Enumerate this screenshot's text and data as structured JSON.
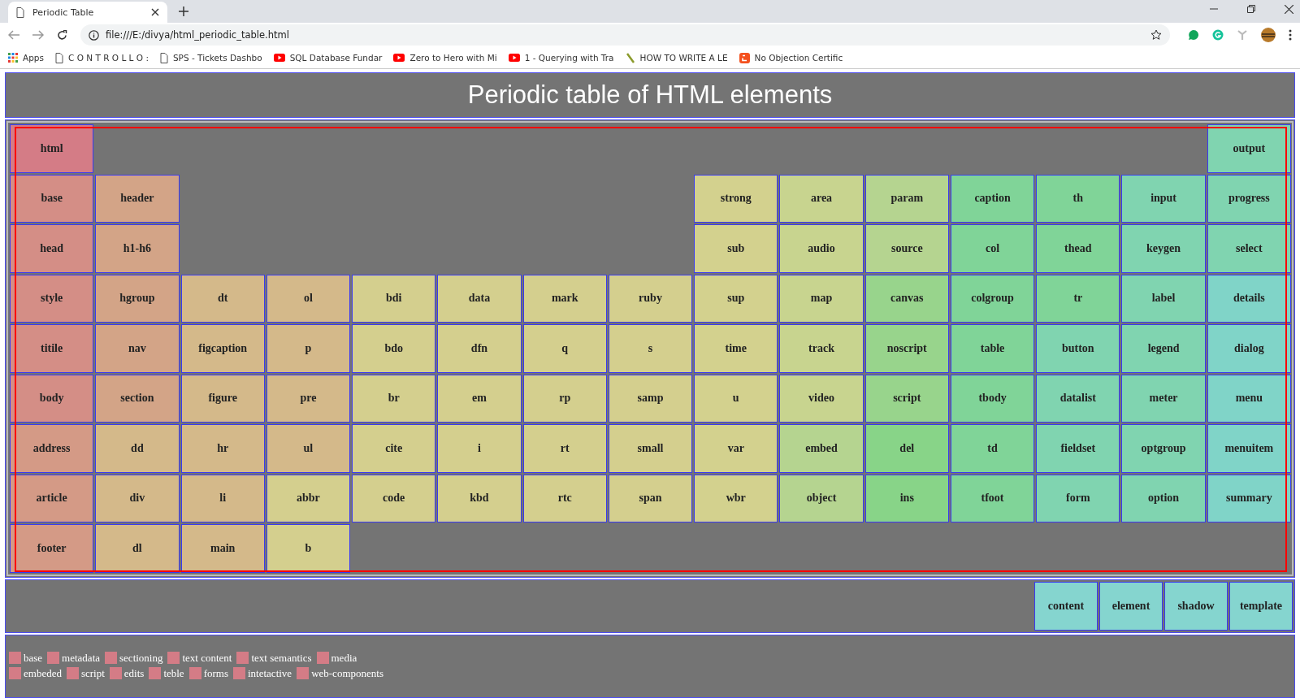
{
  "browser": {
    "tab_title": "Periodic Table",
    "address": "file:///E:/divya/html_periodic_table.html",
    "bookmarks": [
      {
        "label": "Apps",
        "kind": "apps"
      },
      {
        "label": "C O N T R O L L O :",
        "kind": "page"
      },
      {
        "label": "SPS - Tickets Dashbo",
        "kind": "page"
      },
      {
        "label": "SQL Database Fundar",
        "kind": "video"
      },
      {
        "label": "Zero to Hero with Mi",
        "kind": "video"
      },
      {
        "label": "1 - Querying with Tra",
        "kind": "video"
      },
      {
        "label": "HOW TO WRITE A LE",
        "kind": "pen"
      },
      {
        "label": "No Objection Certific",
        "kind": "blog"
      }
    ]
  },
  "page": {
    "title": "Periodic table of HTML elements",
    "rows": [
      [
        {
          "symbol": "html",
          "color": "#d47c86"
        },
        null,
        null,
        null,
        null,
        null,
        null,
        null,
        null,
        null,
        null,
        null,
        null,
        null,
        {
          "symbol": "output",
          "color": "#80d4b0"
        }
      ],
      [
        {
          "symbol": "base",
          "color": "#d48e86"
        },
        {
          "symbol": "header",
          "color": "#d3a487"
        },
        null,
        null,
        null,
        null,
        null,
        null,
        {
          "symbol": "strong",
          "color": "#d3d18e"
        },
        {
          "symbol": "area",
          "color": "#c8d48f"
        },
        {
          "symbol": "param",
          "color": "#b5d490"
        },
        {
          "symbol": "caption",
          "color": "#80d498"
        },
        {
          "symbol": "th",
          "color": "#80d498"
        },
        {
          "symbol": "input",
          "color": "#80d4b0"
        },
        {
          "symbol": "progress",
          "color": "#80d4b0"
        }
      ],
      [
        {
          "symbol": "head",
          "color": "#d48e86"
        },
        {
          "symbol": "h1-h6",
          "color": "#d3a487"
        },
        null,
        null,
        null,
        null,
        null,
        null,
        {
          "symbol": "sub",
          "color": "#d3d18e"
        },
        {
          "symbol": "audio",
          "color": "#c8d48f"
        },
        {
          "symbol": "source",
          "color": "#b5d490"
        },
        {
          "symbol": "col",
          "color": "#80d498"
        },
        {
          "symbol": "thead",
          "color": "#80d498"
        },
        {
          "symbol": "keygen",
          "color": "#80d4b0"
        },
        {
          "symbol": "select",
          "color": "#80d4b0"
        }
      ],
      [
        {
          "symbol": "style",
          "color": "#d48e86"
        },
        {
          "symbol": "hgroup",
          "color": "#d3a487"
        },
        {
          "symbol": "dt",
          "color": "#d4b98a"
        },
        {
          "symbol": "ol",
          "color": "#d4b98a"
        },
        {
          "symbol": "bdi",
          "color": "#d4cf8e"
        },
        {
          "symbol": "data",
          "color": "#d4cf8e"
        },
        {
          "symbol": "mark",
          "color": "#d4cf8e"
        },
        {
          "symbol": "ruby",
          "color": "#d4cf8e"
        },
        {
          "symbol": "sup",
          "color": "#d3d18e"
        },
        {
          "symbol": "map",
          "color": "#c8d48f"
        },
        {
          "symbol": "canvas",
          "color": "#98d48c"
        },
        {
          "symbol": "colgroup",
          "color": "#80d498"
        },
        {
          "symbol": "tr",
          "color": "#80d498"
        },
        {
          "symbol": "label",
          "color": "#80d4b0"
        },
        {
          "symbol": "details",
          "color": "#80d4c8"
        }
      ],
      [
        {
          "symbol": "titile",
          "color": "#d48e86"
        },
        {
          "symbol": "nav",
          "color": "#d3a487"
        },
        {
          "symbol": "figcaption",
          "color": "#d4b98a"
        },
        {
          "symbol": "p",
          "color": "#d4b98a"
        },
        {
          "symbol": "bdo",
          "color": "#d4cf8e"
        },
        {
          "symbol": "dfn",
          "color": "#d4cf8e"
        },
        {
          "symbol": "q",
          "color": "#d4cf8e"
        },
        {
          "symbol": "s",
          "color": "#d4cf8e"
        },
        {
          "symbol": "time",
          "color": "#d3d18e"
        },
        {
          "symbol": "track",
          "color": "#c8d48f"
        },
        {
          "symbol": "noscript",
          "color": "#98d48c"
        },
        {
          "symbol": "table",
          "color": "#80d498"
        },
        {
          "symbol": "button",
          "color": "#80d4b0"
        },
        {
          "symbol": "legend",
          "color": "#80d4b0"
        },
        {
          "symbol": "dialog",
          "color": "#80d4c8"
        }
      ],
      [
        {
          "symbol": "body",
          "color": "#d48e86"
        },
        {
          "symbol": "section",
          "color": "#d3a487"
        },
        {
          "symbol": "figure",
          "color": "#d4b98a"
        },
        {
          "symbol": "pre",
          "color": "#d4b98a"
        },
        {
          "symbol": "br",
          "color": "#d4cf8e"
        },
        {
          "symbol": "em",
          "color": "#d4cf8e"
        },
        {
          "symbol": "rp",
          "color": "#d4cf8e"
        },
        {
          "symbol": "samp",
          "color": "#d4cf8e"
        },
        {
          "symbol": "u",
          "color": "#d3d18e"
        },
        {
          "symbol": "video",
          "color": "#c8d48f"
        },
        {
          "symbol": "script",
          "color": "#98d48c"
        },
        {
          "symbol": "tbody",
          "color": "#80d498"
        },
        {
          "symbol": "datalist",
          "color": "#80d4b0"
        },
        {
          "symbol": "meter",
          "color": "#80d4b0"
        },
        {
          "symbol": "menu",
          "color": "#80d4c8"
        }
      ],
      [
        {
          "symbol": "address",
          "color": "#d49a86"
        },
        {
          "symbol": "dd",
          "color": "#d4b98a"
        },
        {
          "symbol": "hr",
          "color": "#d4b98a"
        },
        {
          "symbol": "ul",
          "color": "#d4b98a"
        },
        {
          "symbol": "cite",
          "color": "#d4cf8e"
        },
        {
          "symbol": "i",
          "color": "#d4cf8e"
        },
        {
          "symbol": "rt",
          "color": "#d4cf8e"
        },
        {
          "symbol": "small",
          "color": "#d4cf8e"
        },
        {
          "symbol": "var",
          "color": "#d3d18e"
        },
        {
          "symbol": "embed",
          "color": "#b5d490"
        },
        {
          "symbol": "del",
          "color": "#88d488"
        },
        {
          "symbol": "td",
          "color": "#80d498"
        },
        {
          "symbol": "fieldset",
          "color": "#80d4b0"
        },
        {
          "symbol": "optgroup",
          "color": "#80d4b0"
        },
        {
          "symbol": "menuitem",
          "color": "#80d4c8"
        }
      ],
      [
        {
          "symbol": "article",
          "color": "#d49a86"
        },
        {
          "symbol": "div",
          "color": "#d4b98a"
        },
        {
          "symbol": "li",
          "color": "#d4b98a"
        },
        {
          "symbol": "abbr",
          "color": "#d4cf8e"
        },
        {
          "symbol": "code",
          "color": "#d4cf8e"
        },
        {
          "symbol": "kbd",
          "color": "#d4cf8e"
        },
        {
          "symbol": "rtc",
          "color": "#d4cf8e"
        },
        {
          "symbol": "span",
          "color": "#d4cf8e"
        },
        {
          "symbol": "wbr",
          "color": "#d3d18e"
        },
        {
          "symbol": "object",
          "color": "#b5d490"
        },
        {
          "symbol": "ins",
          "color": "#88d488"
        },
        {
          "symbol": "tfoot",
          "color": "#80d498"
        },
        {
          "symbol": "form",
          "color": "#80d4b0"
        },
        {
          "symbol": "option",
          "color": "#80d4b0"
        },
        {
          "symbol": "summary",
          "color": "#80d4c8"
        }
      ],
      [
        {
          "symbol": "footer",
          "color": "#d49a86"
        },
        {
          "symbol": "dl",
          "color": "#d4b98a"
        },
        {
          "symbol": "main",
          "color": "#d4b98a"
        },
        {
          "symbol": "b",
          "color": "#d4cf8e"
        },
        null,
        null,
        null,
        null,
        null,
        null,
        null,
        null,
        null,
        null,
        null
      ]
    ],
    "extras": [
      {
        "symbol": "content",
        "color": "#85d5cf"
      },
      {
        "symbol": "element",
        "color": "#85d5cf"
      },
      {
        "symbol": "shadow",
        "color": "#85d5cf"
      },
      {
        "symbol": "template",
        "color": "#85d5cf"
      }
    ],
    "legend": [
      [
        {
          "label": "base",
          "color": "#d47c86"
        },
        {
          "label": "metadata",
          "color": "#d47c86"
        },
        {
          "label": "sectioning",
          "color": "#d47c86"
        },
        {
          "label": "text content",
          "color": "#d47c86"
        },
        {
          "label": "text semantics",
          "color": "#d47c86"
        },
        {
          "label": "media",
          "color": "#d47c86"
        }
      ],
      [
        {
          "label": "embeded",
          "color": "#d47c86"
        },
        {
          "label": "script",
          "color": "#d47c86"
        },
        {
          "label": "edits",
          "color": "#d47c86"
        },
        {
          "label": "teble",
          "color": "#d47c86"
        },
        {
          "label": "forms",
          "color": "#d47c86"
        },
        {
          "label": "intetactive",
          "color": "#d47c86"
        },
        {
          "label": "web-components",
          "color": "#d47c86"
        }
      ]
    ]
  }
}
